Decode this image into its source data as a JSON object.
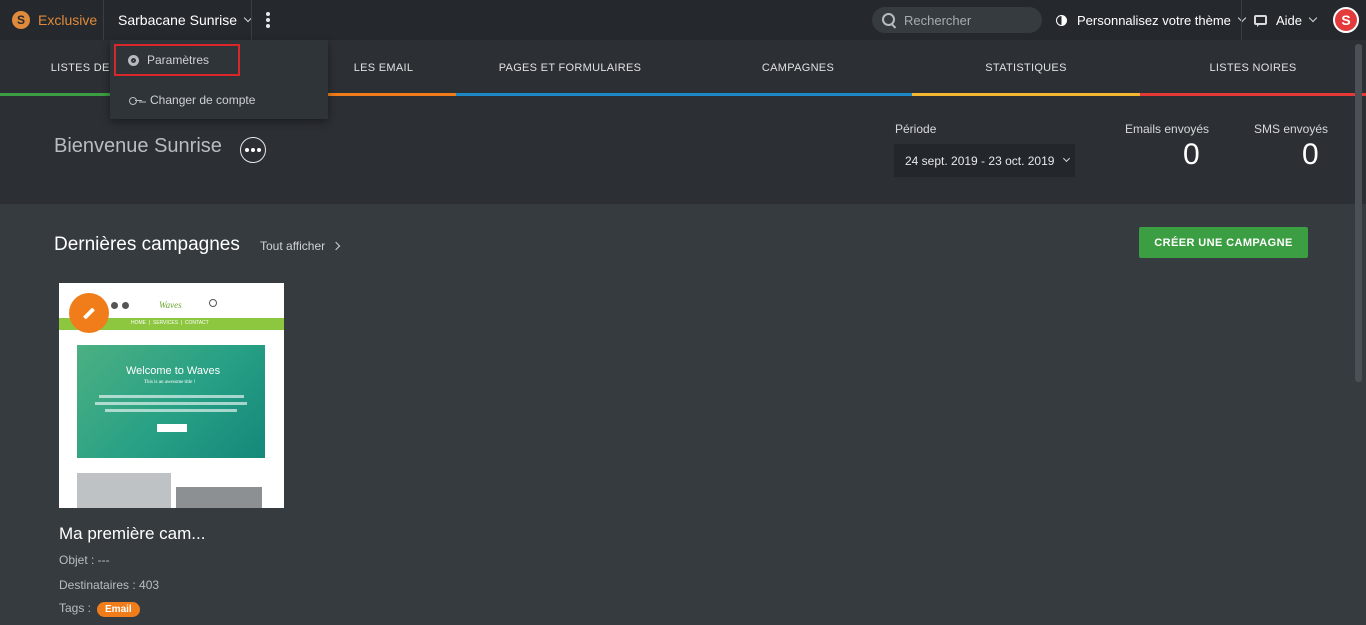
{
  "topbar": {
    "brand_logo": "S",
    "brand_name": "Exclusive",
    "account_name": "Sarbacane Sunrise",
    "search_placeholder": "Rechercher",
    "theme_label": "Personnalisez votre thème",
    "help_label": "Aide",
    "avatar_letter": "S",
    "icons": [
      "search-icon",
      "drop-icon",
      "chat-icon",
      "chevron-down-icon",
      "kebab-icon"
    ]
  },
  "account_menu": {
    "items": [
      {
        "label": "Paramètres",
        "icon": "gear-icon",
        "highlighted": true
      },
      {
        "label": "Changer de compte",
        "icon": "key-icon"
      }
    ]
  },
  "nav": {
    "items": [
      {
        "label": "LISTES DES",
        "color": "#3c9e42"
      },
      {
        "label": "LES EMAIL",
        "color": "#f07d1a"
      },
      {
        "label": "PAGES ET FORMULAIRES",
        "color": "#1e88c7"
      },
      {
        "label": "CAMPAGNES",
        "color": "#1e88c7"
      },
      {
        "label": "STATISTIQUES",
        "color": "#f5b731"
      },
      {
        "label": "LISTES NOIRES",
        "color": "#e53935"
      }
    ]
  },
  "welcome": {
    "title": "Bienvenue Sunrise",
    "period_label": "Période",
    "period_value": "24 sept. 2019 - 23 oct. 2019",
    "emails_label": "Emails envoyés",
    "emails_value": "0",
    "sms_label": "SMS envoyés",
    "sms_value": "0"
  },
  "campaigns": {
    "title": "Dernières campagnes",
    "see_all": "Tout afficher",
    "create_button": "CRÉER UNE CAMPAGNE",
    "items": [
      {
        "name": "Ma première cam...",
        "object": "Objet : ---",
        "recipients": "Destinataires : 403",
        "tags_label": "Tags :",
        "tag": "Email",
        "thumbnail": {
          "logo": "Waves",
          "menu": "HOME  |  SERVICES  |  CONTACT",
          "hero_title": "Welcome to Waves",
          "hero_subtitle": "This is an awesome title !"
        }
      }
    ]
  },
  "colors": {
    "accent_green": "#3c9e42",
    "accent_orange": "#f07d1a",
    "avatar_red": "#e33b3b",
    "highlight_red": "#d9262b"
  }
}
